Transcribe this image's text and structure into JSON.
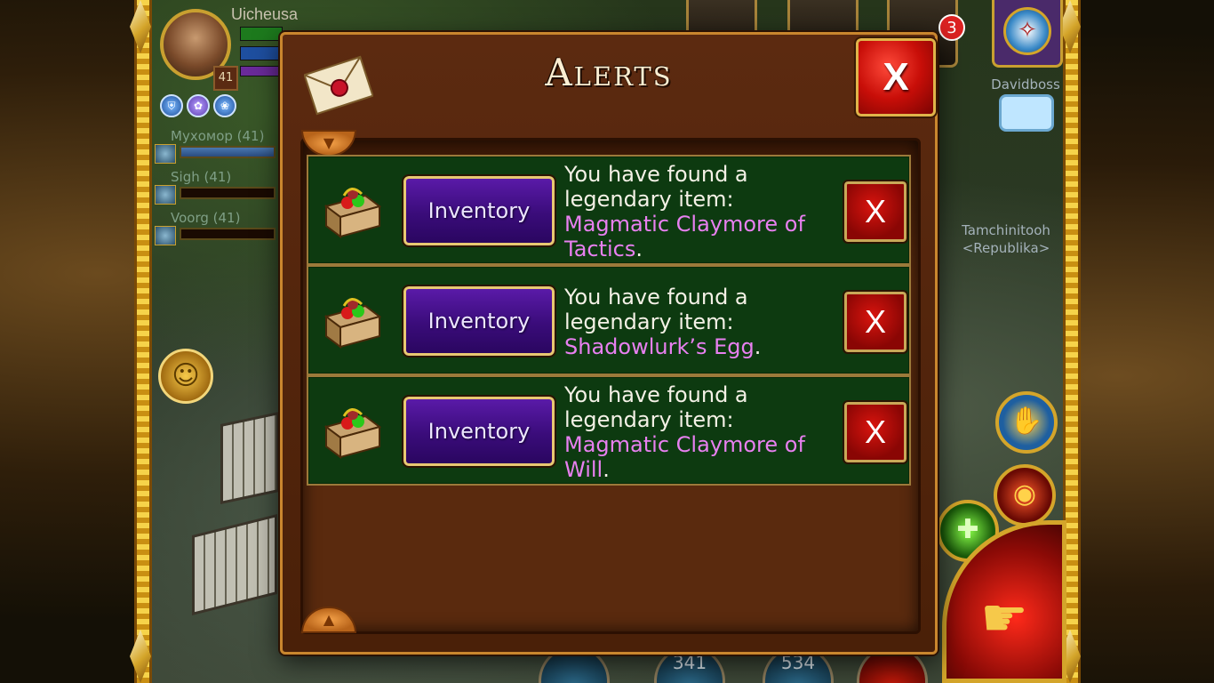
{
  "player": {
    "name": "Uicheusa",
    "level": "41"
  },
  "party": [
    {
      "name": "Мухомор (41)",
      "fill": 1.0
    },
    {
      "name": "Sigh (41)",
      "fill": 0.0
    },
    {
      "name": "Voorg (41)",
      "fill": 0.0
    }
  ],
  "hud": {
    "notification_count": "3",
    "nearby_player_1": "Davidboss",
    "nearby_player_2_name": "Tamchinitooh",
    "nearby_player_2_guild": "<Republika>",
    "bottom_counter_1": "341",
    "bottom_counter_2": "534"
  },
  "dialog": {
    "title": "Alerts",
    "close_label": "X",
    "alerts": [
      {
        "button_label": "Inventory",
        "message": "You have found a legendary item:",
        "item": "Magmatic Claymore of Tactics",
        "suffix": ".",
        "close_label": "X"
      },
      {
        "button_label": "Inventory",
        "message": "You have found a legendary item:",
        "item": "Shadowlurk’s Egg",
        "suffix": ".",
        "close_label": "X"
      },
      {
        "button_label": "Inventory",
        "message": "You have found a legendary item:",
        "item": "Magmatic Claymore of Will",
        "suffix": ".",
        "close_label": "X"
      }
    ]
  },
  "colors": {
    "dialog_bg": "#5c2a10",
    "alert_row_bg": "#0d3a10",
    "inventory_button": "#3a0c7a",
    "legendary_item_text": "#e880f0",
    "close_button": "#c80e08"
  },
  "icons": {
    "dialog": "envelope-icon",
    "alert": "treasure-chest-icon"
  }
}
